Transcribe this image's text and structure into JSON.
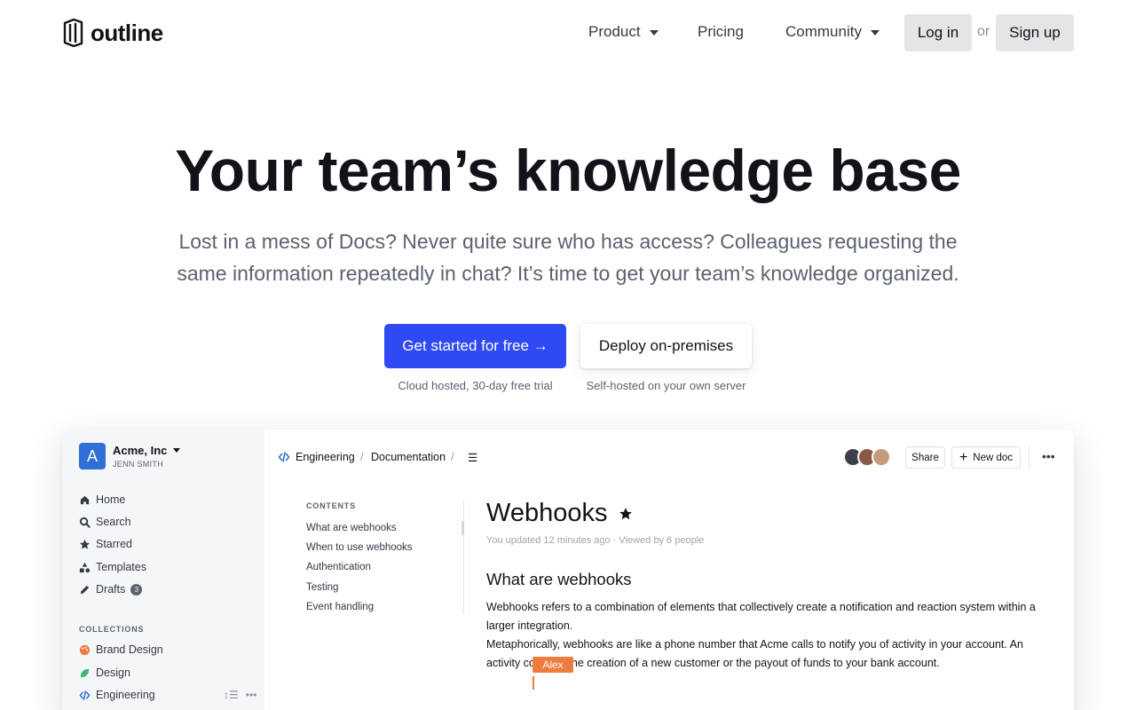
{
  "nav": {
    "logo_text": "outline",
    "links": [
      {
        "label": "Product"
      },
      {
        "label": "Pricing"
      },
      {
        "label": "Community"
      }
    ],
    "login_label": "Log in",
    "or_text": "or",
    "signup_label": "Sign up"
  },
  "hero": {
    "title": "Your team’s knowledge base",
    "subtitle": "Lost in a mess of Docs? Never quite sure who has access? Colleagues requesting the same information repeatedly in chat? It’s time to get your team’s knowledge organized.",
    "primary_cta": "Get started for free →",
    "primary_note": "Cloud hosted, 30-day free trial",
    "secondary_cta": "Deploy on-premises",
    "secondary_note": "Self-hosted on your own server"
  },
  "app": {
    "team": {
      "avatar_letter": "A",
      "name": "Acme, Inc",
      "user": "JENN SMITH"
    },
    "sidebar": {
      "items": [
        {
          "label": "Home",
          "icon": "home-icon"
        },
        {
          "label": "Search",
          "icon": "search-icon"
        },
        {
          "label": "Starred",
          "icon": "star-icon"
        },
        {
          "label": "Templates",
          "icon": "shapes-icon"
        },
        {
          "label": "Drafts",
          "icon": "pencil-icon",
          "badge": "3"
        }
      ],
      "collections_heading": "COLLECTIONS",
      "collections": [
        {
          "label": "Brand Design",
          "icon": "palette-icon",
          "color": "#ef7c3f"
        },
        {
          "label": "Design",
          "icon": "leaf-icon",
          "color": "#3fb57a"
        },
        {
          "label": "Engineering",
          "icon": "code-icon",
          "color": "#2f6fd6"
        }
      ]
    },
    "breadcrumb": {
      "collection": "Engineering",
      "separator": "/",
      "document": "Documentation"
    },
    "toolbar": {
      "share_label": "Share",
      "new_doc_label": "New doc"
    },
    "toc": {
      "heading": "CONTENTS",
      "items": [
        "What are webhooks",
        "When to use webhooks",
        "Authentication",
        "Testing",
        "Event handling"
      ]
    },
    "doc": {
      "title": "Webhooks",
      "meta": "You updated 12 minutes ago · Viewed by 6 people",
      "h2": "What are webhooks",
      "body": "Webhooks refers to a combination of elements that collectively create a notification and reaction system within a larger integration.\nMetaphorically, webhooks are like a phone number that Acme calls to notify you of activity in your account. An activity could be the creation of a new customer or the payout of funds to your bank account.",
      "cursor_user": "Alex"
    },
    "colors": {
      "primary": "#2f4af5",
      "sidebar_bg": "#f4f6f8",
      "cursor": "#ef7c3f"
    }
  }
}
